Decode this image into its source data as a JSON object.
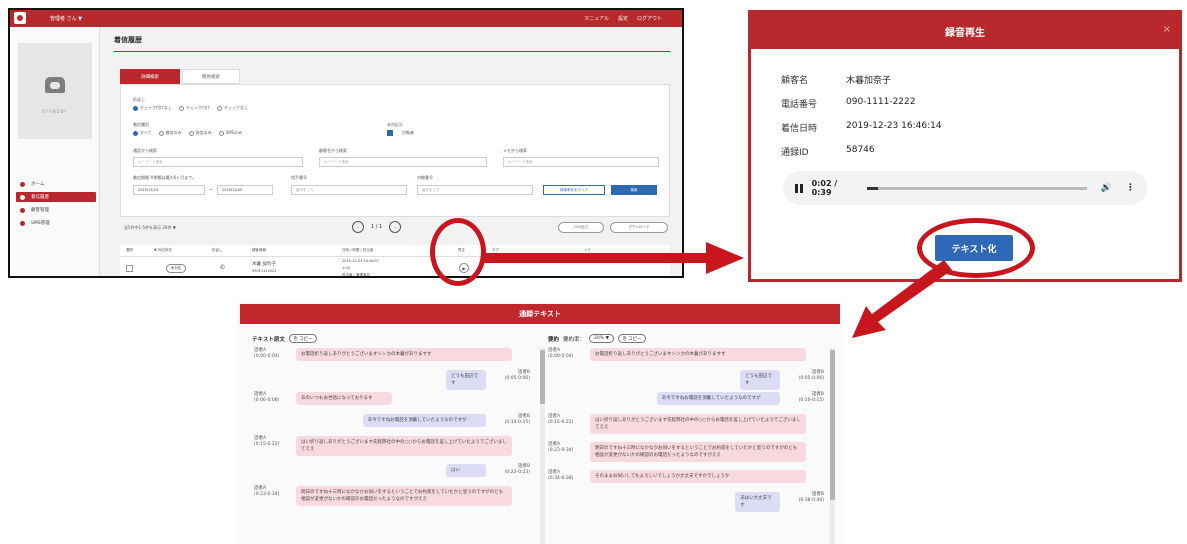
{
  "panel1": {
    "topbar": {
      "user": "管理者 さん ▼",
      "links": [
        "マニュアル",
        "設定",
        "ログアウト"
      ]
    },
    "sidebar": {
      "standby": "STANDBY",
      "nav": [
        {
          "label": "ホーム"
        },
        {
          "label": "着信履歴"
        },
        {
          "label": "顧客管理"
        },
        {
          "label": "SMS管理"
        }
      ]
    },
    "page_title": "着信履歴",
    "tabs": [
      "詳細検索",
      "簡易検索"
    ],
    "form": {
      "check_label": "折返し",
      "check_options": [
        "チェック付けなし",
        "チェック付け",
        "チェックなし"
      ],
      "status_label": "着信種別",
      "status_options": [
        "すべて",
        "着信のみ",
        "発信のみ",
        "SMSのみ"
      ],
      "unread_label": "未対応分",
      "unread_check": "対象者",
      "f1_label": "通話から検索",
      "f1_ph": "キーワード検索",
      "f2_label": "顧客名から検索",
      "f2_ph": "キーワード検索",
      "f3_label": "メモから検索",
      "f3_ph": "キーワード検索",
      "date_label": "着信期間 ※期間は最大6ヶ月まで。",
      "date_from": "2019/11/24",
      "date_to": "2019/12/09",
      "tel_label": "相手番号",
      "tel_ph": "番号を入力",
      "ext_label": "内線番号",
      "ext_ph": "番号を入力",
      "clear_btn": "検索条件をクリア",
      "search_btn": "検索"
    },
    "list": {
      "count": "全5件中1-5件を表示 20件 ▼",
      "page": "1 / 1",
      "csv_btn": "CSV出力",
      "download_btn": "ダウンロード",
      "headers": [
        "選択",
        "▼ 対応状況",
        "折返し",
        "顧客情報",
        "日時 / 時間 / 担当者",
        "再生",
        "タグ",
        "メモ"
      ],
      "row": {
        "status": "未対応",
        "customer_name": "木暮 加奈子",
        "customer_tel": "09011112222",
        "datetime": "2019-12-23 16:46:57",
        "duration": "1:00",
        "operator": "担当者：管理者名"
      }
    }
  },
  "panel2": {
    "title": "録音再生",
    "close": "×",
    "fields": [
      {
        "label": "顧客名",
        "value": "木暮加奈子"
      },
      {
        "label": "電話番号",
        "value": "090-1111-2222"
      },
      {
        "label": "着信日時",
        "value": "2019-12-23 16:46:14"
      },
      {
        "label": "通録ID",
        "value": "58746"
      }
    ],
    "audio": {
      "time": "0:02 / 0:39",
      "progress": 0.05
    },
    "text_button": "テキスト化"
  },
  "panel3": {
    "title": "通録テキスト",
    "left": {
      "label": "テキスト原文",
      "copy": "コピー",
      "messages": [
        {
          "side": "left",
          "speaker": "話者A",
          "time": "(0:00-0:04)",
          "text": "お電話折り返しありがとうございますシンカの木暮がありますす"
        },
        {
          "side": "right",
          "speaker": "話者B",
          "time": "(0:05-0:06)",
          "text": "どうも田辺です"
        },
        {
          "side": "left",
          "speaker": "話者A",
          "time": "(0:06-0:08)",
          "text": "あのいつもお世話になっております"
        },
        {
          "side": "right",
          "speaker": "話者B",
          "time": "(0:10-0:15)",
          "text": "あ今ですねお電話を頂戴していたようなのですが"
        },
        {
          "side": "left",
          "speaker": "話者A",
          "time": "(0:15-0:22)",
          "text": "はい折り返しありがとうございます先程弊社の中の○○からお電話を差し上げていたようでございましてええ"
        },
        {
          "side": "right",
          "speaker": "話者B",
          "time": "(0:22-0:23)",
          "text": "はい"
        },
        {
          "side": "left",
          "speaker": "話者A",
          "time": "(0:23-0:34)",
          "text": "明日のですね十三時になかなかお伺いをするということでお約束をしていたかと思うのですがのども相談が変更がないかの確認のお電話だったようなのですがええ"
        }
      ]
    },
    "right": {
      "label": "要約",
      "rate_label": "要約率：",
      "rate": "20% ▼",
      "copy": "コピー",
      "messages": [
        {
          "side": "left",
          "speaker": "話者A",
          "time": "(0:00-0:04)",
          "text": "お電話折り返しありがとうございますシンカの木暮がありますす"
        },
        {
          "side": "right",
          "speaker": "話者B",
          "time": "(0:05-0:06)",
          "text": "どうも田辺です"
        },
        {
          "side": "right",
          "speaker": "話者B",
          "time": "(0:10-0:15)",
          "text": "あ今ですねお電話を頂戴していたようなのですが"
        },
        {
          "side": "left",
          "speaker": "話者A",
          "time": "(0:15-0:22)",
          "text": "はい折り返しありがとうございます先程弊社の中の○○からお電話を差し上げていたようでございましてええ"
        },
        {
          "side": "left",
          "speaker": "話者A",
          "time": "(0:23-0:34)",
          "text": "明日のですね十三時になかなかお伺いをするということでお約束をしていたかと思うのですがのども相談が変更がないかの確認のお電話だったようなのですがええ"
        },
        {
          "side": "left",
          "speaker": "話者A",
          "time": "(0:34-0:38)",
          "text": "そのままお伺いしてもよろしいでしょうか大丈夫ですかでしょうか"
        },
        {
          "side": "right",
          "speaker": "話者B",
          "time": "(0:38-0:40)",
          "text": "あはい大丈夫です"
        }
      ]
    }
  },
  "colors": {
    "brand_red": "#b8282c",
    "accent_blue": "#3068b8",
    "arrow_red": "#c8161e",
    "bubble_pink": "#f8d9df",
    "bubble_lavender": "#dcdcf5"
  }
}
